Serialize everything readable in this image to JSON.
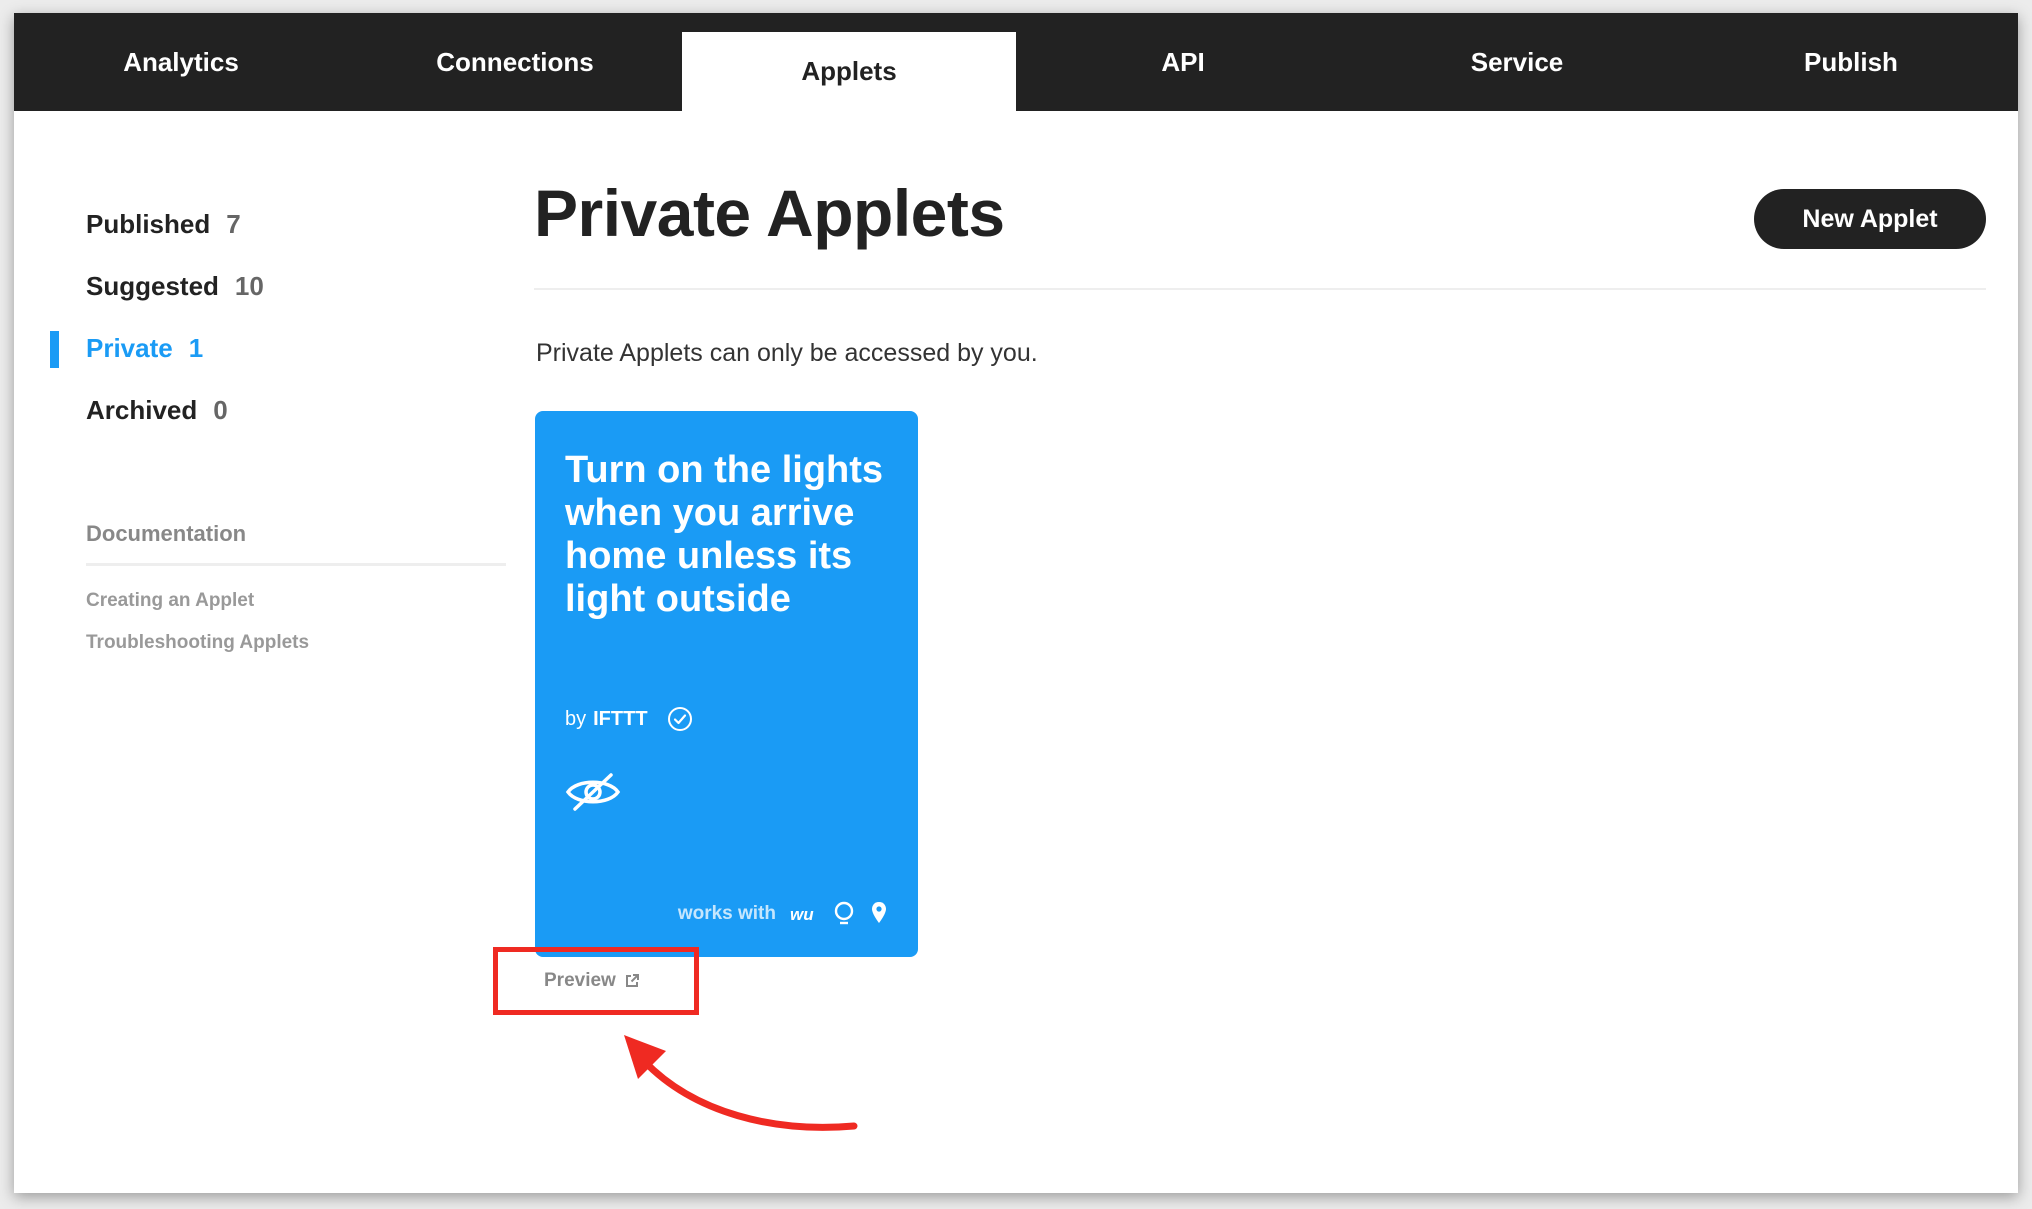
{
  "nav": {
    "tabs": [
      {
        "label": "Analytics",
        "active": false
      },
      {
        "label": "Connections",
        "active": false
      },
      {
        "label": "Applets",
        "active": true
      },
      {
        "label": "API",
        "active": false
      },
      {
        "label": "Service",
        "active": false
      },
      {
        "label": "Publish",
        "active": false
      }
    ]
  },
  "sidebar": {
    "items": [
      {
        "label": "Published",
        "count": "7",
        "active": false
      },
      {
        "label": "Suggested",
        "count": "10",
        "active": false
      },
      {
        "label": "Private",
        "count": "1",
        "active": true
      },
      {
        "label": "Archived",
        "count": "0",
        "active": false
      }
    ],
    "documentation": {
      "title": "Documentation",
      "links": [
        "Creating an Applet",
        "Troubleshooting Applets"
      ]
    }
  },
  "main": {
    "title": "Private Applets",
    "new_button": "New Applet",
    "subtitle": "Private Applets can only be accessed by you."
  },
  "applet_card": {
    "title": "Turn on the lights when you arrive home unless its light outside",
    "by_prefix": "by",
    "author": "IFTTT",
    "works_with": "works with",
    "services_icons": [
      "weather-underground-icon",
      "light-bulb-icon",
      "location-pin-icon"
    ],
    "preview_label": "Preview"
  },
  "colors": {
    "nav_bg": "#222222",
    "accent": "#1a9bf5",
    "annotation": "#ef2a22"
  }
}
